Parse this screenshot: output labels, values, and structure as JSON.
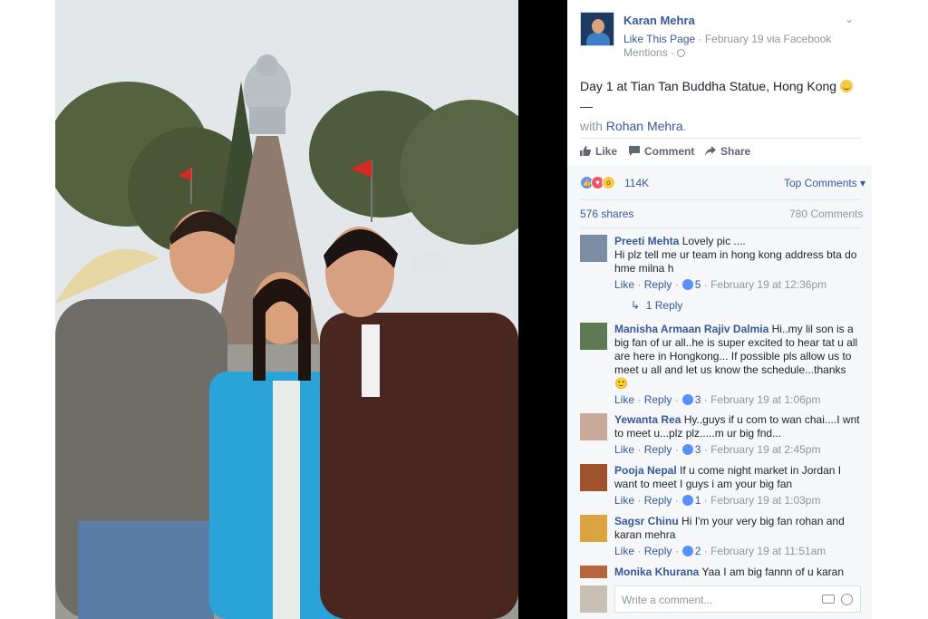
{
  "post": {
    "page_name": "Karan Mehra",
    "like_page": "Like This Page",
    "date_source": " · February 19 via Facebook",
    "mentions": "Mentions ·",
    "caption": "Day 1 at Tian Tan Buddha Statue, Hong Kong ",
    "caption_dash": " —",
    "with_text": "with ",
    "tagged": "Rohan Mehra",
    "period": "."
  },
  "actions": {
    "like": "Like",
    "comment": "Comment",
    "share": "Share"
  },
  "stats": {
    "reaction_count": "114K",
    "top_comments": "Top Comments ▾",
    "shares": "576 shares",
    "comments": "780 Comments"
  },
  "comments": [
    {
      "name": "Preeti Mehta",
      "text": "Lovely pic ....\nHi plz tell me ur team in hong kong address bta do hme milna h",
      "like": "Like",
      "reply": "Reply",
      "likes": "5",
      "time": "February 19 at 12:36pm",
      "replies": "1 Reply",
      "avatar_color": "#7b8da3"
    },
    {
      "name": "Manisha Armaan Rajiv Dalmia",
      "text": "Hi..my lil son is a big fan of ur all..he is super excited to hear tat u all are here in Hongkong... If possible pls allow us to meet u all and let us know the schedule...thanks 🙂",
      "like": "Like",
      "reply": "Reply",
      "likes": "3",
      "time": "February 19 at 1:06pm",
      "avatar_color": "#5d7a55"
    },
    {
      "name": "Yewanta Rea",
      "text": "Hy..guys if u com to wan chai....I wnt to meet u...plz plz.....m ur big fnd...",
      "like": "Like",
      "reply": "Reply",
      "likes": "3",
      "time": "February 19 at 2:45pm",
      "avatar_color": "#c9a99a"
    },
    {
      "name": "Pooja Nepal",
      "text": "If u come night market in Jordan I want to meet I guys i am your big fan",
      "like": "Like",
      "reply": "Reply",
      "likes": "1",
      "time": "February 19 at 1:03pm",
      "avatar_color": "#a0522d"
    },
    {
      "name": "Sagsr Chinu",
      "text": "Hi I'm your very big fan rohan and karan mehra",
      "like": "Like",
      "reply": "Reply",
      "likes": "2",
      "time": "February 19 at 11:51am",
      "avatar_color": "#d9a441"
    },
    {
      "name": "Monika Khurana",
      "text": "Yaa I am big fannn of u karan",
      "avatar_color": "#b5653f"
    }
  ],
  "write_comment": {
    "placeholder": "Write a comment..."
  }
}
